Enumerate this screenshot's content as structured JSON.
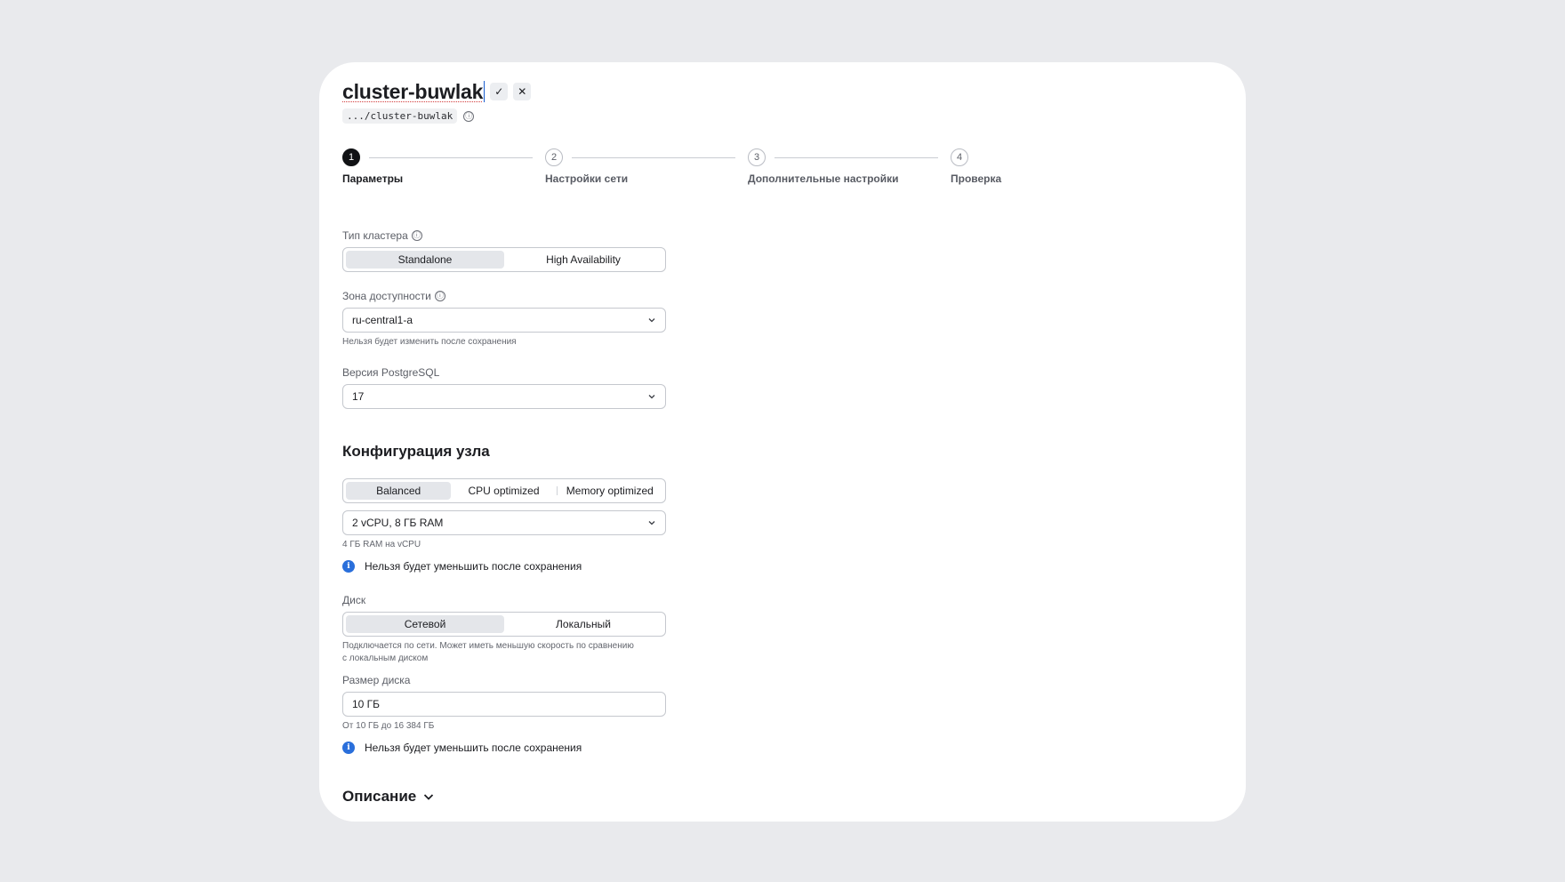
{
  "header": {
    "cluster_name": "cluster-buwlak",
    "confirm_symbol": "✓",
    "cancel_symbol": "✕",
    "path": ".../cluster-buwlak"
  },
  "stepper": {
    "steps": [
      {
        "number": "1",
        "label": "Параметры",
        "active": true
      },
      {
        "number": "2",
        "label": "Настройки сети",
        "active": false
      },
      {
        "number": "3",
        "label": "Дополнительные настройки",
        "active": false
      },
      {
        "number": "4",
        "label": "Проверка",
        "active": false
      }
    ]
  },
  "form": {
    "cluster_type": {
      "label": "Тип кластера",
      "options": [
        "Standalone",
        "High Availability"
      ],
      "selected": "Standalone"
    },
    "availability_zone": {
      "label": "Зона доступности",
      "value": "ru-central1-a",
      "hint": "Нельзя будет изменить после сохранения"
    },
    "postgres_version": {
      "label": "Версия PostgreSQL",
      "value": "17"
    },
    "node_config": {
      "title": "Конфигурация узла",
      "options": [
        "Balanced",
        "CPU optimized",
        "Memory optimized"
      ],
      "selected": "Balanced",
      "preset_value": "2 vCPU, 8 ГБ RAM",
      "preset_hint": "4 ГБ RAM на vCPU",
      "notice": "Нельзя будет уменьшить после сохранения"
    },
    "disk": {
      "label": "Диск",
      "options": [
        "Сетевой",
        "Локальный"
      ],
      "selected": "Сетевой",
      "hint_line1": "Подключается по сети. Может иметь меньшую скорость по сравнению",
      "hint_line2": "с локальным диском"
    },
    "disk_size": {
      "label": "Размер диска",
      "value": "10 ГБ",
      "hint": "От 10 ГБ до 16 384 ГБ",
      "notice": "Нельзя будет уменьшить после сохранения"
    },
    "description": {
      "title": "Описание"
    }
  },
  "colors": {
    "background": "#e9eaed",
    "card": "#ffffff",
    "accent_info": "#2a6fdb",
    "step_active": "#111215"
  },
  "icons": {
    "info_outline": "ⓘ",
    "info_filled": "i",
    "chevron": "chevron-down-icon"
  }
}
